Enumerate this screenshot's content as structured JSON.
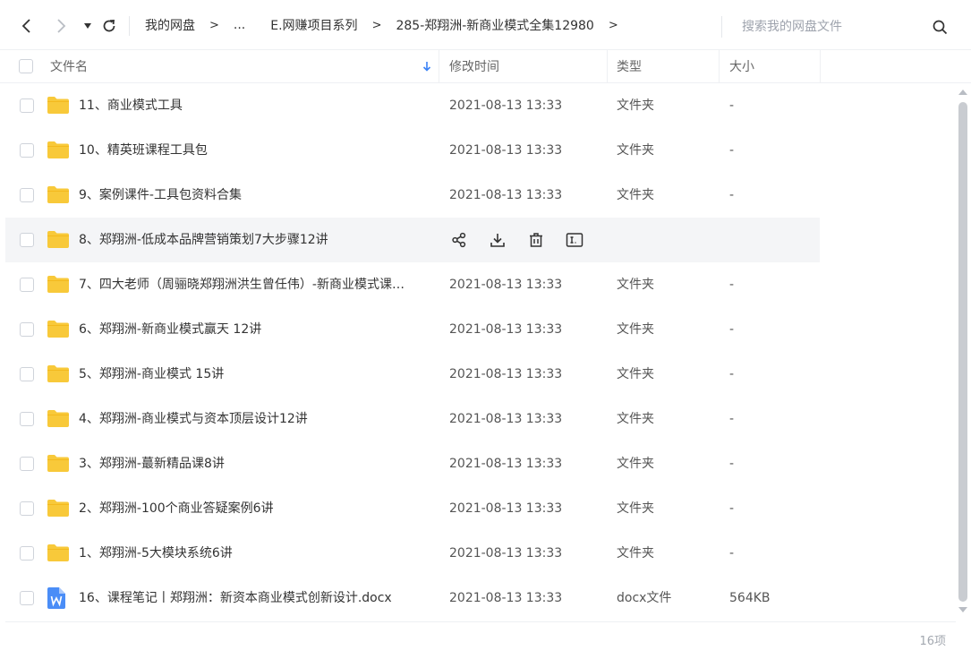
{
  "nav": {
    "back_icon": "chevron-left-icon",
    "forward_icon": "chevron-right-icon",
    "dropdown_icon": "caret-down-icon",
    "refresh_icon": "refresh-icon"
  },
  "breadcrumb": {
    "items": [
      "我的网盘",
      "...",
      "E.网赚项目系列",
      "285-郑翔洲-新商业模式全集12980"
    ],
    "separator": ">"
  },
  "search": {
    "placeholder": "搜索我的网盘文件",
    "icon": "search-icon"
  },
  "table": {
    "columns": {
      "name": "文件名",
      "modified": "修改时间",
      "type": "类型",
      "size": "大小"
    },
    "sort_icon": "arrow-down-icon",
    "rows": [
      {
        "name": "11、商业模式工具",
        "date": "2021-08-13 13:33",
        "type": "文件夹",
        "size": "-",
        "icon": "folder-icon"
      },
      {
        "name": "10、精英班课程工具包",
        "date": "2021-08-13 13:33",
        "type": "文件夹",
        "size": "-",
        "icon": "folder-icon"
      },
      {
        "name": "9、案例课件-工具包资料合集",
        "date": "2021-08-13 13:33",
        "type": "文件夹",
        "size": "-",
        "icon": "folder-icon"
      },
      {
        "name": "8、郑翔洲-低成本品牌营销策划7大步骤12讲",
        "date": "",
        "type": "",
        "size": "",
        "icon": "folder-icon",
        "hovered": true
      },
      {
        "name": "7、四大老师（周骊晓郑翔洲洪生曾任伟）-新商业模式课…",
        "date": "2021-08-13 13:33",
        "type": "文件夹",
        "size": "-",
        "icon": "folder-icon"
      },
      {
        "name": "6、郑翔洲-新商业模式赢天 12讲",
        "date": "2021-08-13 13:33",
        "type": "文件夹",
        "size": "-",
        "icon": "folder-icon"
      },
      {
        "name": "5、郑翔洲-商业模式 15讲",
        "date": "2021-08-13 13:33",
        "type": "文件夹",
        "size": "-",
        "icon": "folder-icon"
      },
      {
        "name": "4、郑翔洲-商业模式与资本顶层设计12讲",
        "date": "2021-08-13 13:33",
        "type": "文件夹",
        "size": "-",
        "icon": "folder-icon"
      },
      {
        "name": "3、郑翔洲-蕞新精品课8讲",
        "date": "2021-08-13 13:33",
        "type": "文件夹",
        "size": "-",
        "icon": "folder-icon"
      },
      {
        "name": "2、郑翔洲-100个商业答疑案例6讲",
        "date": "2021-08-13 13:33",
        "type": "文件夹",
        "size": "-",
        "icon": "folder-icon"
      },
      {
        "name": "1、郑翔洲-5大模块系统6讲",
        "date": "2021-08-13 13:33",
        "type": "文件夹",
        "size": "-",
        "icon": "folder-icon"
      },
      {
        "name": "16、课程笔记丨郑翔洲：新资本商业模式创新设计.docx",
        "date": "2021-08-13 13:33",
        "type": "docx文件",
        "size": "564KB",
        "icon": "word-doc-icon"
      }
    ],
    "row_actions": [
      "share-icon",
      "download-icon",
      "delete-icon",
      "rename-icon"
    ]
  },
  "footer": {
    "count": "16项"
  },
  "colors": {
    "folder": "#f8c93a",
    "doc": "#4a8df7",
    "accent": "#3b82f6"
  }
}
